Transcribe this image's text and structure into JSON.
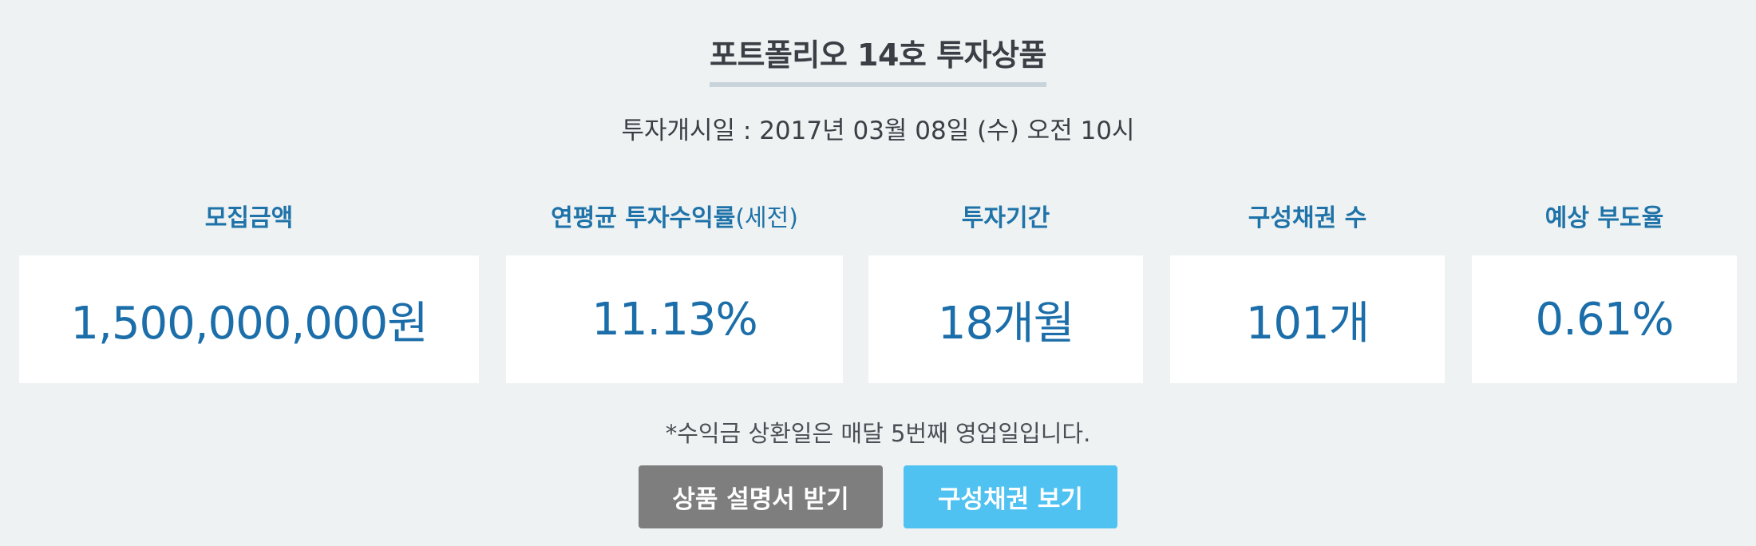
{
  "header": {
    "title": "포트폴리오 14호 투자상품",
    "start_date": "투자개시일 : 2017년 03월 08일 (수) 오전 10시"
  },
  "stats": [
    {
      "label": "모집금액",
      "label_suffix": "",
      "value": "1,500,000,000원"
    },
    {
      "label": "연평균 투자수익률",
      "label_suffix": "(세전)",
      "value": "11.13%"
    },
    {
      "label": "투자기간",
      "label_suffix": "",
      "value": "18개월"
    },
    {
      "label": "구성채권 수",
      "label_suffix": "",
      "value": "101개"
    },
    {
      "label": "예상 부도율",
      "label_suffix": "",
      "value": "0.61%"
    }
  ],
  "note": "*수익금 상환일은 매달 5번째 영업일입니다.",
  "buttons": {
    "prospectus": "상품 설명서 받기",
    "view_bonds": "구성채권 보기"
  },
  "colors": {
    "background": "#eef2f3",
    "accent_text": "#1b6ea9",
    "button_grey": "#7e7e7e",
    "button_blue": "#4fc2f2"
  }
}
